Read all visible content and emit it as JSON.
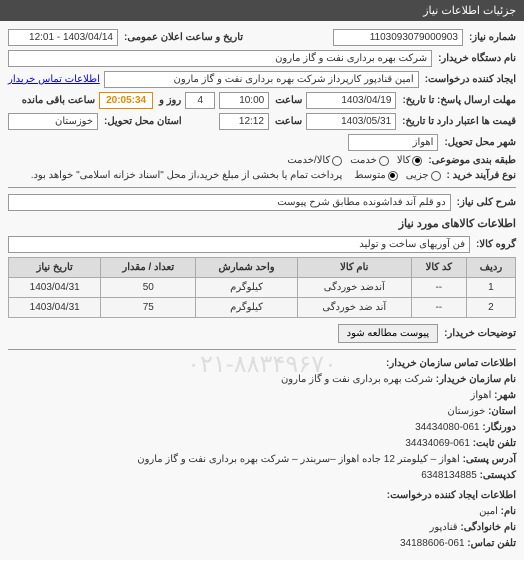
{
  "title_bar": "جزئیات اطلاعات نیاز",
  "fields": {
    "number_label": "شماره نیاز:",
    "number_value": "1103093079000903",
    "ann_time_label": "تاریخ و ساعت اعلان عمومی:",
    "ann_time_value": "1403/04/14 - 12:01",
    "buyer_org_label": "نام دستگاه خریدار:",
    "buyer_org_value": "شرکت بهره برداری نفت و گاز مارون",
    "creator_label": "ایجاد کننده درخواست:",
    "creator_value": "امین قنادپور کارپرداز شرکت بهره برداری نفت و گاز مارون",
    "buyer_contact_link": "اطلاعات تماس خریدار",
    "resp_deadline_label": "مهلت ارسال پاسخ: تا تاریخ:",
    "resp_deadline_date": "1403/04/19",
    "time_label": "ساعت",
    "resp_deadline_time": "10:00",
    "days_and": "روز و",
    "days_value": "4",
    "countdown": "20:05:34",
    "remaining_label": "ساعت باقی مانده",
    "validity_label": "قیمت ها اعتبار دارد تا تاریخ:",
    "validity_date": "1403/05/31",
    "validity_time": "12:12",
    "delivery_province_label": "استان محل تحویل:",
    "delivery_province_value": "خوزستان",
    "delivery_city_label": "شهر محل تحویل:",
    "delivery_city_value": "اهواز",
    "category_label": "طبقه بندی موضوعی:",
    "cat_goods": "کالا",
    "cat_service": "خدمت",
    "cat_goods_service": "کالا/خدمت",
    "purchase_type_label": "نوع فرآیند خرید :",
    "pt_small": "جزیی",
    "pt_medium": "متوسط",
    "purchase_note": "پرداخت تمام یا بخشی از مبلغ خرید،از محل \"اسناد خزانه اسلامی\" خواهد بود.",
    "general_desc_label": "شرح کلی نیاز:",
    "general_desc_value": "دو قلم آند فداشونده مطابق شرح پیوست",
    "items_header": "اطلاعات کالاهای مورد نیاز",
    "goods_group_label": "گروه کالا:",
    "goods_group_value": "فن آوریهای ساخت و تولید",
    "buyer_notes_label": "توضیحات خریدار:",
    "attachment_button": "پیوست مطالعه شود"
  },
  "table": {
    "headers": {
      "row": "ردیف",
      "code": "کد کالا",
      "name": "نام کالا",
      "unit": "واحد شمارش",
      "qty": "تعداد / مقدار",
      "date": "تاریخ نیاز"
    },
    "rows": [
      {
        "row": "1",
        "code": "--",
        "name": "آندضد خوردگی",
        "unit": "کیلوگرم",
        "qty": "50",
        "date": "1403/04/31"
      },
      {
        "row": "2",
        "code": "--",
        "name": "آند ضد خوردگی",
        "unit": "کیلوگرم",
        "qty": "75",
        "date": "1403/04/31"
      }
    ]
  },
  "contact_info": {
    "header": "اطلاعات تماس سازمان خریدار:",
    "org_label": "نام سازمان خریدار:",
    "org_value": "شرکت بهره برداری نفت و گاز مارون",
    "city_label": "شهر:",
    "city_value": "اهواز",
    "province_label": "استان:",
    "province_value": "خوزستان",
    "fax_label": "دورنگار:",
    "fax_value": "061-34434080",
    "phone_label": "تلفن ثابت:",
    "phone_value": "061-34434069",
    "address_label": "آدرس پستی:",
    "address_value": "اهواز – کیلومتر 12 جاده اهواز –سربندر – شرکت بهره برداری نفت و گاز مارون",
    "postcode_label": "کدپستی:",
    "postcode_value": "6348134885",
    "creator_header": "اطلاعات ایجاد کننده درخواست:",
    "name_label": "نام:",
    "name_value": "امین",
    "surname_label": "نام خانوادگی:",
    "surname_value": "قنادپور",
    "contact_phone_label": "تلفن تماس:",
    "contact_phone_value": "061-34188606"
  },
  "watermark": "۰۲۱-۸۸۳۴۹۶۷۰"
}
